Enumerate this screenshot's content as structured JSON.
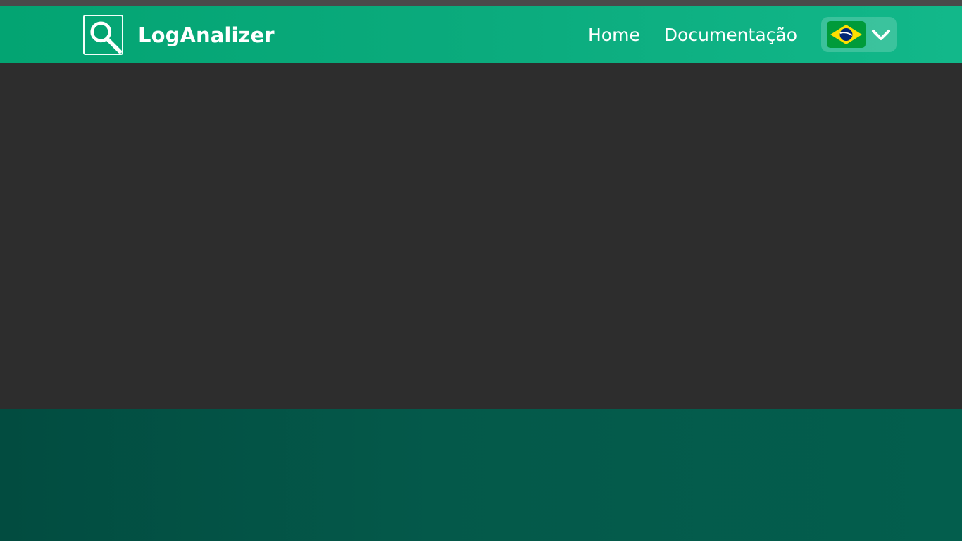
{
  "header": {
    "brand_name": "LogAnalizer",
    "logo_icon": "magnifier-icon",
    "nav": [
      {
        "label": "Home"
      },
      {
        "label": "Documentação"
      }
    ],
    "language": {
      "selected": "pt-BR",
      "flag_icon": "brazil-flag-icon",
      "chevron_icon": "chevron-down-icon"
    }
  },
  "colors": {
    "accent": "#0bab7d",
    "background": "#2d2d2d",
    "footer": "#04594a"
  }
}
